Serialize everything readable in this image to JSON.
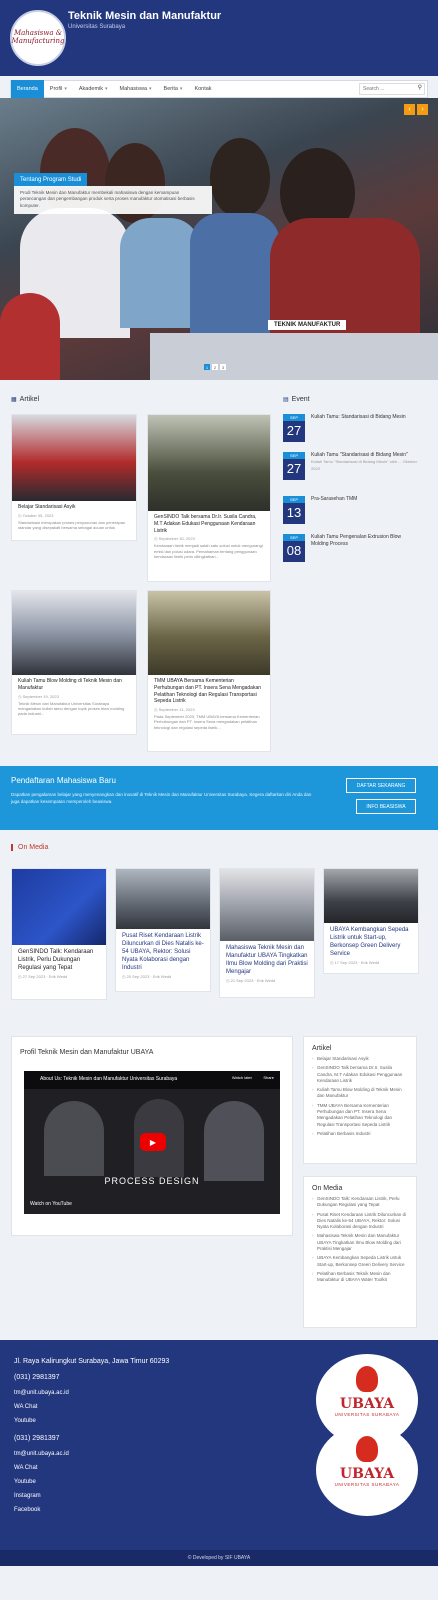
{
  "header": {
    "logo_text": "Mahasiswa & Manufacturing",
    "title": "Teknik Mesin dan Manufaktur",
    "subtitle": "Universitas Surabaya"
  },
  "nav": {
    "items": [
      "Beranda",
      "Profil",
      "Akademik",
      "Mahasiswa",
      "Berita",
      "Kontak"
    ],
    "search_placeholder": "Search ..."
  },
  "hero": {
    "badge": "TEKNIK MANUFAKTUR",
    "caption_title": "Tentang Program Studi",
    "caption_text": "Prodi Teknik Mesin dan Manufaktur membekali mahasiswa dengan kemampuan perancangan dan pengembangan produk serta proses manufaktur otomatisasi berbasis komputer.",
    "dots": [
      "1",
      "2",
      "3"
    ]
  },
  "articles": {
    "heading": "Artikel",
    "items": [
      {
        "title": "Belajar Standarisasi Asyik",
        "date": "October 05, 2023",
        "excerpt": "Standarisasi merupakan proses penyusunan dan penerapan standar yang disepakati bersama sebagai acuan untuk menjamin mutu..."
      },
      {
        "title": "GenSINDO Talk bersama Dr.Ir. Susila Candra, M.T Adakan Edukasi Penggunaan Kendaraan Listrik",
        "date": "September 30, 2023",
        "excerpt": "Kendaraan listrik menjadi salah satu solusi untuk mengurangi emisi dan polusi udara. Pemahaman tentang penggunaan kendaraan listrik perlu ditingkatkan..."
      },
      {
        "title": "Kuliah Tamu Blow Molding di Teknik Mesin dan Manufaktur",
        "date": "September 19, 2023",
        "excerpt": "Teknik Mesin dan Manufaktur Universitas Surabaya mengadakan kuliah tamu dengan topik proses blow molding pada industri..."
      },
      {
        "title": "TMM UBAYA Bersama Kementerian Perhubungan dan PT. Insera Sena Mengadakan Pelatihan Teknologi dan Regulasi Transportasi Sepeda Listrik",
        "date": "September 11, 2023",
        "excerpt": "Pada September 2023, TMM UBAYA bersama Kementerian Perhubungan dan PT. Insera Sena mengadakan pelatihan teknologi dan regulasi sepeda listrik..."
      }
    ]
  },
  "events": {
    "heading": "Event",
    "items": [
      {
        "month": "SEP",
        "day": "27",
        "title": "Kuliah Tamu: Standarisasi di Bidang Mesin",
        "note": ""
      },
      {
        "month": "SEP",
        "day": "27",
        "title": "Kuliah Tamu \"Standarisasi di Bidang Mesin\"",
        "note": "Kuliah Tamu \"Standarisasi di Bidang Mesin\" oleh ... Oktober 2023"
      },
      {
        "month": "SEP",
        "day": "13",
        "title": "Pra-Sarasehan TMM",
        "note": ""
      },
      {
        "month": "SEP",
        "day": "08",
        "title": "Kuliah Tamu Pengenalan Extrusion Blow Molding Process",
        "note": ""
      }
    ]
  },
  "admission": {
    "title": "Pendaftaran Mahasiswa Baru",
    "text": "Dapatkan pengalaman belajar yang menyenangkan dan inovatif di Teknik Mesin dan Manufaktur Universitas Surabaya. Segera daftarkan diri Anda dan juga dapatkan kesempatan memperoleh beasiswa.",
    "btn_register": "DAFTAR SEKARANG",
    "btn_scholarship": "INFO BEASISWA"
  },
  "on_media": {
    "heading": "On Media",
    "items": [
      {
        "title": "GenSINDO Talk: Kendaraan Listrik, Perlu Dukungan Regulasi yang Tepat",
        "date": "27 Sep 2023",
        "author": "Erik Wedd"
      },
      {
        "title": "Pusat Riset Kendaraan Listrik Diluncurkan di Dies Natalis ke-54 UBAYA, Rektor: Solusi Nyata Kolaborasi dengan Industri",
        "date": "20 Sep 2023",
        "author": "Erik Wedd"
      },
      {
        "title": "Mahasiswa Teknik Mesin dan Manufaktur UBAYA Tingkatkan Ilmu Blow Molding dari Praktisi Mengajar",
        "date": "21 Sep 2023",
        "author": "Erik Wedd"
      },
      {
        "title": "UBAYA Kembangkan Sepeda Listrik untuk Start-up, Berkonsep Green Delivery Service",
        "date": "17 Sep 2023",
        "author": "Erik Wedd"
      }
    ]
  },
  "profile": {
    "title": "Profil Teknik Mesin dan Manufaktur UBAYA",
    "video_title": "About Us: Teknik Mesin dan Manufaktur Universitas Surabaya",
    "watch_later": "Watch later",
    "share": "Share",
    "video_label": "PROCESS DESIGN",
    "watch_on": "Watch on YouTube"
  },
  "sidebar": {
    "articles_title": "Artikel",
    "articles": [
      "Belajar Standarisasi Asyik",
      "GenSINDO Talk bersama Dr.Ir. Susila Candra, M.T Adakan Edukasi Penggunaan Kendaraan Listrik",
      "Kuliah Tamu Blow Molding di Teknik Mesin dan Manufaktur",
      "TMM UBAYA Bersama Kementerian Perhubungan dan PT. Insera Sena Mengadakan Pelatihan Teknologi dan Regulasi Transportasi Sepeda Listrik",
      "Pelatihan Berbasis Industri"
    ],
    "media_title": "On Media",
    "media": [
      "GenSINDO Talk: Kendaraan Listrik, Perlu Dukungan Regulasi yang Tepat",
      "Pusat Riset Kendaraan Listrik Diluncurkan di Dies Natalis ke-54 UBAYA, Rektor: Solusi Nyata Kolaborasi dengan Industri",
      "Mahasiswa Teknik Mesin dan Manufaktur UBAYA Tingkatkan Ilmu Blow Molding dari Praktisi Mengajar",
      "UBAYA Kembangkan Sepeda Listrik untuk Start-up, Berkonsep Green Delivery Service",
      "Pelatihan Berbasis Teknik Mesin dan Manufaktur di UBAYA Water Toolkit"
    ]
  },
  "footer": {
    "address": "Jl. Raya Kalirungkut Surabaya, Jawa Timur 60293",
    "phone": "(031) 2981397",
    "email": "tm@unit.ubaya.ac.id",
    "links_a": [
      "WA Chat",
      "Youtube"
    ],
    "phone2": "(031) 2981397",
    "email2": "tm@unit.ubaya.ac.id",
    "links_b": [
      "WA Chat",
      "Youtube",
      "Instagram",
      "Facebook"
    ],
    "ubaya_name": "UBAYA",
    "ubaya_uni": "UNIVERSITAS SURABAYA",
    "copyright": "© Developed by SIF UBAYA"
  },
  "colors": {
    "primary": "#23377f",
    "accent": "#1a8fd8",
    "arrow": "#f39c12",
    "media_heading": "#c0392b"
  }
}
